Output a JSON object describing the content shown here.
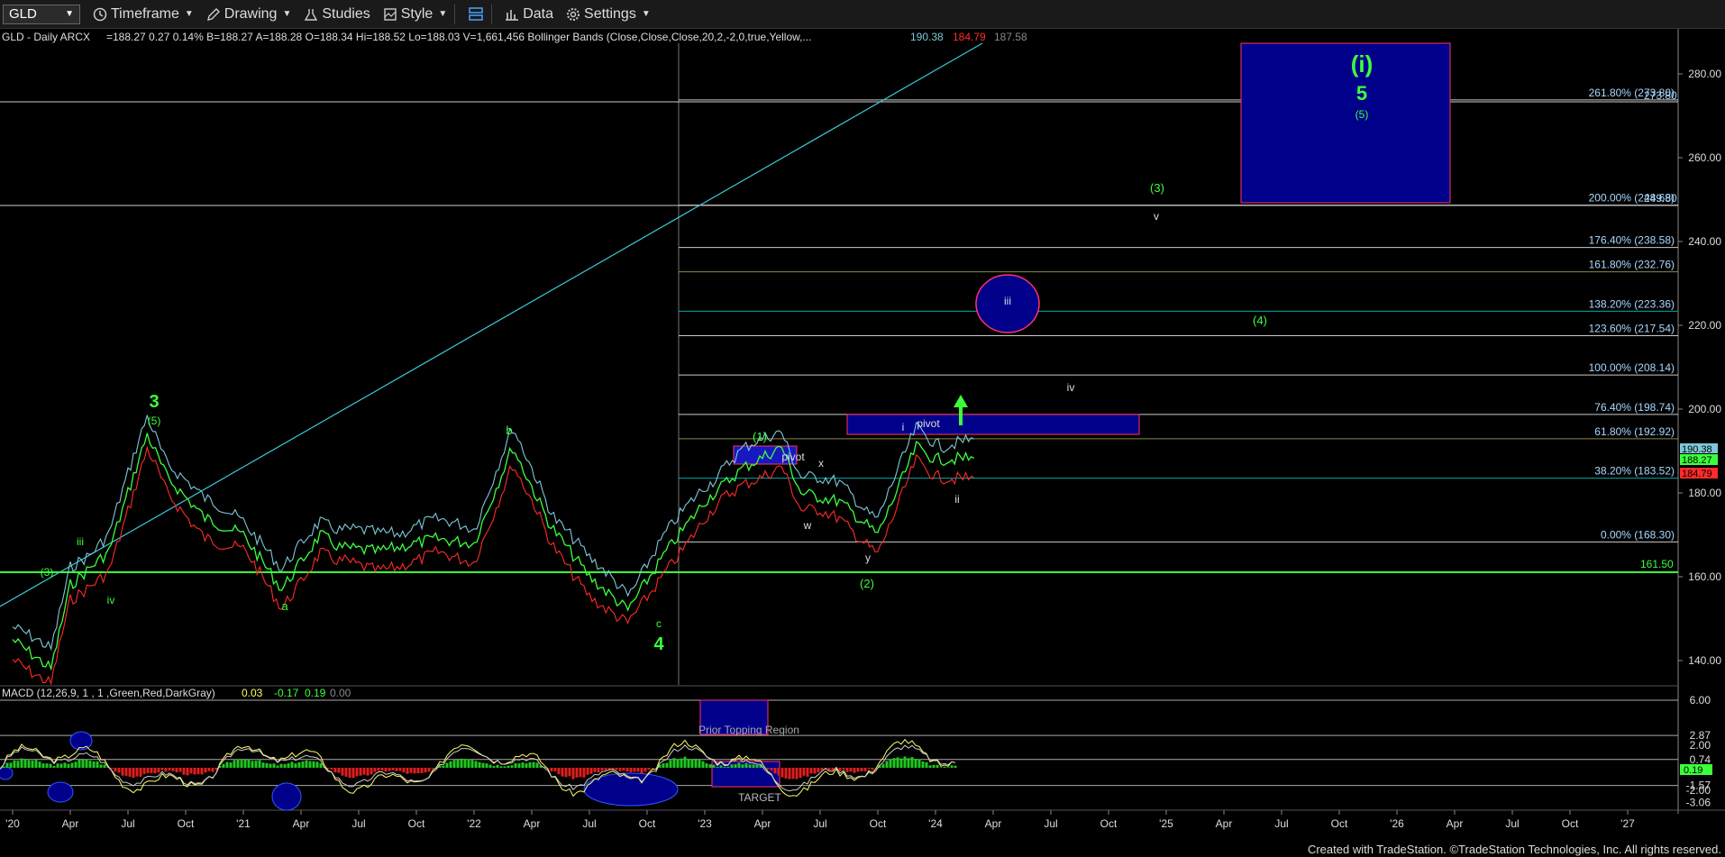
{
  "toolbar": {
    "symbol": "GLD",
    "items": [
      {
        "label": "Timeframe",
        "icon": "clock-icon"
      },
      {
        "label": "Drawing",
        "icon": "pencil-icon"
      },
      {
        "label": "Studies",
        "icon": "flask-icon"
      },
      {
        "label": "Style",
        "icon": "style-icon"
      },
      {
        "label": "",
        "icon": "layout-icon"
      },
      {
        "label": "Data",
        "icon": "bar-chart-icon"
      },
      {
        "label": "Settings",
        "icon": "gear-icon"
      }
    ]
  },
  "header": {
    "symbol_line": "GLD - Daily  ARCX",
    "quote": "=188.27  0.27  0.14%  B=188.27  A=188.28  O=188.34  Hi=188.52  Lo=188.03  V=1,661,456  Bollinger Bands (Close,Close,Close,20,2,-2,0,true,Yellow,...",
    "bb_upper": "190.38",
    "bb_lower": "184.79",
    "bb_mid": "187.58"
  },
  "macd_header": {
    "label": "MACD (12,26,9, 1 , 1 ,Green,Red,DarkGray)",
    "v1": "0.03",
    "v2": "-0.17",
    "v3": "0.19",
    "v4": "0.00"
  },
  "colors": {
    "bb_upper": "#7ec8d8",
    "bb_lower": "#ff2a2a",
    "price": "#3cff3c",
    "fib_text": "#a8d8ff",
    "wave_green": "#3cff3c",
    "blue_box": "#00008b",
    "box_border": "#ff3366"
  },
  "price_axis": {
    "labels": [
      "280.00",
      "260.00",
      "240.00",
      "220.00",
      "200.00",
      "180.00",
      "160.00",
      "140.00"
    ],
    "badge_upper": "190.38",
    "badge_close": "188.27",
    "badge_lower": "184.79"
  },
  "fib_levels": [
    {
      "label": "261.80% (273.80)",
      "value": 273.8
    },
    {
      "label": "200.00% (248.68)",
      "value": 248.68
    },
    {
      "label": "176.40% (238.58)",
      "value": 238.58
    },
    {
      "label": "161.80% (232.76)",
      "value": 232.76
    },
    {
      "label": "138.20% (223.36)",
      "value": 223.36
    },
    {
      "label": "123.60% (217.54)",
      "value": 217.54
    },
    {
      "label": "100.00% (208.14)",
      "value": 208.14
    },
    {
      "label": "76.40% (198.74)",
      "value": 198.74
    },
    {
      "label": "61.80% (192.92)",
      "value": 192.92
    },
    {
      "label": "38.20% (183.52)",
      "value": 183.52
    },
    {
      "label": "0.00% (168.30)",
      "value": 168.3
    }
  ],
  "fib_overlap_labels": [
    "273.80",
    "249.80"
  ],
  "support_level": {
    "label": "161.50",
    "value": 161.5
  },
  "wave_labels": {
    "w3": "3",
    "w3_sub": "(5)",
    "w4": "4",
    "w5": "5",
    "wi": "(i)",
    "w5_sub": "(5)",
    "iii_small": "iii",
    "iv_small": "iv",
    "three_small": "(3)",
    "a": "a",
    "b": "b",
    "c": "c",
    "one": "(1)",
    "two": "(2)",
    "three_future": "(3)",
    "four_future": "(4)",
    "w": "w",
    "x": "x",
    "y": "y",
    "i_blue": "i",
    "ii_blue": "ii",
    "iii_circle": "iii",
    "iv_future": "iv",
    "v_future": "v"
  },
  "annotations": {
    "pivot1": "pivot",
    "pivot2": "pivot",
    "prior_topping": "Prior Topping Region",
    "target": "TARGET"
  },
  "macd_axis": {
    "labels": [
      "6.00",
      "2.87",
      "2.00",
      "0.74",
      "0.19",
      "-1.57",
      "-2.00",
      "-3.06"
    ]
  },
  "time_axis": {
    "labels": [
      "'20",
      "Apr",
      "Jul",
      "Oct",
      "'21",
      "Apr",
      "Jul",
      "Oct",
      "'22",
      "Apr",
      "Jul",
      "Oct",
      "'23",
      "Apr",
      "Jul",
      "Oct",
      "'24",
      "Apr",
      "Jul",
      "Oct",
      "'25",
      "Apr",
      "Jul",
      "Oct",
      "'26",
      "Apr",
      "Jul",
      "Oct",
      "'27"
    ]
  },
  "footer": {
    "credit": "Created with TradeStation. ©TradeStation Technologies, Inc. All rights reserved."
  },
  "chart_data": {
    "type": "line",
    "title": "GLD - Daily  ARCX",
    "x_start": "2020-01",
    "x_end": "2027-01",
    "ylim": [
      135,
      285
    ],
    "series": [
      {
        "name": "GLD",
        "x": [
          "2020-01",
          "2020-03",
          "2020-04",
          "2020-06",
          "2020-08",
          "2020-09",
          "2020-11",
          "2021-01",
          "2021-03",
          "2021-05",
          "2021-06",
          "2021-08",
          "2021-11",
          "2022-01",
          "2022-03",
          "2022-05",
          "2022-07",
          "2022-09",
          "2022-11",
          "2023-01",
          "2023-03",
          "2023-05",
          "2023-06",
          "2023-08",
          "2023-10",
          "2023-12",
          "2024-01",
          "2024-03"
        ],
        "values": [
          145,
          138,
          158,
          166,
          194,
          184,
          174,
          170,
          157,
          170,
          167,
          166,
          169,
          168,
          191,
          172,
          160,
          152,
          166,
          178,
          186,
          191,
          180,
          178,
          170,
          191,
          188,
          188.27
        ]
      }
    ],
    "ylabel": "",
    "xlabel": ""
  }
}
